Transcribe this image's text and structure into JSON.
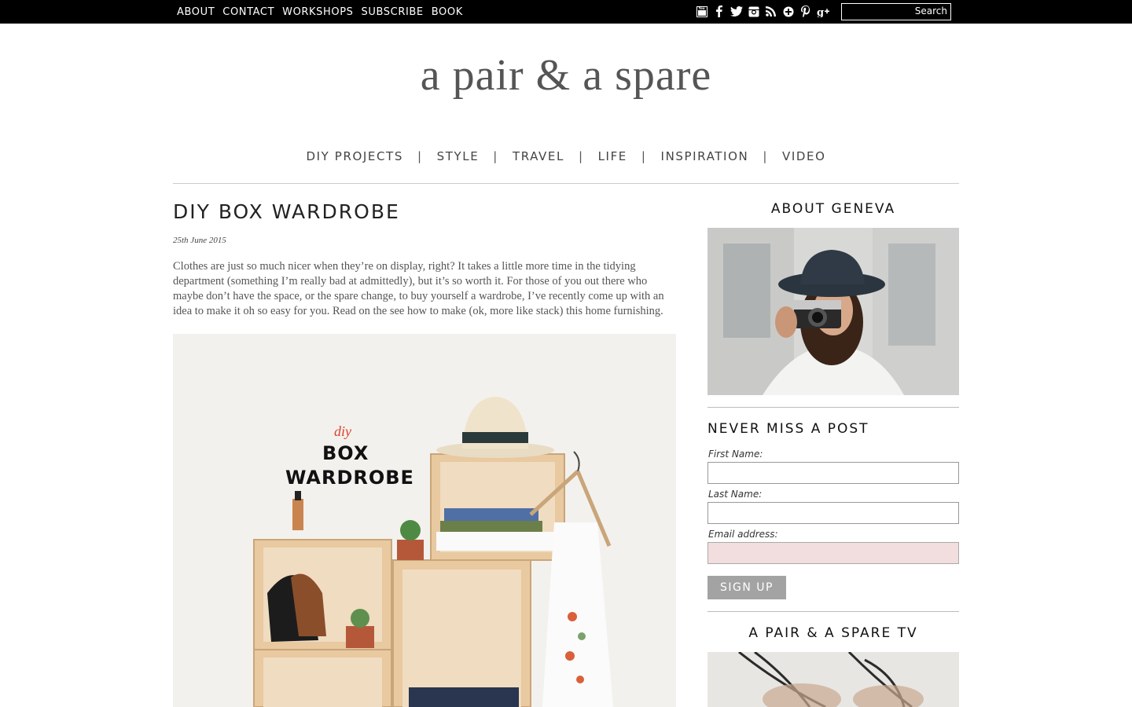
{
  "topnav": {
    "items": [
      "ABOUT",
      "CONTACT",
      "WORKSHOPS",
      "SUBSCRIBE",
      "BOOK"
    ],
    "social_icons": [
      "youtube-icon",
      "facebook-icon",
      "twitter-icon",
      "instagram-icon",
      "rss-icon",
      "bloglovin-icon",
      "pinterest-icon",
      "google-plus-icon"
    ],
    "search_label": "Search",
    "search_value": ""
  },
  "logo": "a pair & a spare",
  "categories": [
    "DIY PROJECTS",
    "STYLE",
    "TRAVEL",
    "LIFE",
    "INSPIRATION",
    "VIDEO"
  ],
  "category_separator": "|",
  "post": {
    "title": "DIY BOX WARDROBE",
    "date": "25th June 2015",
    "body_lines": [
      "Clothes are just so much nicer when they’re on display, right? It takes a little more time in the tidying",
      "department (something I’m really bad at admittedly), but it’s so worth it. For those of you out there who",
      "maybe don’t have the space, or the spare change, to buy yourself a wardrobe, I’ve recently come up with an",
      "idea to make it oh so easy for you. Read on the see how to make (ok, more like stack) this home furnishing."
    ],
    "hero": {
      "kicker": "diy",
      "line1": "BOX",
      "line2": "WARDROBE"
    }
  },
  "sidebar": {
    "about_heading": "ABOUT GENEVA",
    "newsletter_heading": "NEVER MISS A POST",
    "first_name_label": "First Name:",
    "last_name_label": "Last Name:",
    "email_label": "Email address:",
    "first_name_value": "",
    "last_name_value": "",
    "email_value": "",
    "signup_label": "SIGN UP",
    "tv_heading": "A PAIR & A SPARE TV"
  },
  "colors": {
    "topbar": "#000000",
    "signup_button": "#a3a3a3",
    "email_field": "#f2dede",
    "hero_accent": "#d9412c"
  }
}
